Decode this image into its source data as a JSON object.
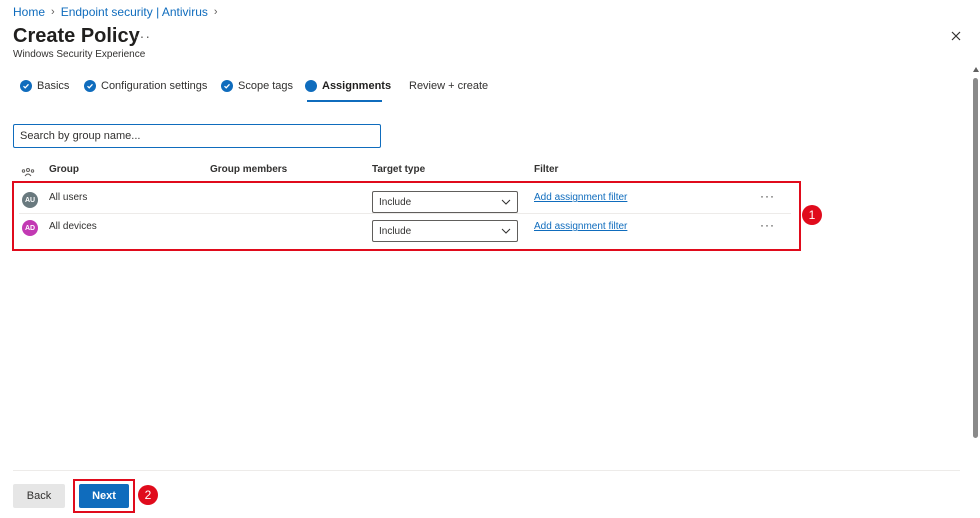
{
  "breadcrumb": {
    "items": [
      "Home",
      "Endpoint security | Antivirus"
    ]
  },
  "page": {
    "title": "Create Policy",
    "more": "···",
    "subtitle": "Windows Security Experience"
  },
  "tabs": [
    {
      "label": "Basics",
      "state": "completed"
    },
    {
      "label": "Configuration settings",
      "state": "completed"
    },
    {
      "label": "Scope tags",
      "state": "completed"
    },
    {
      "label": "Assignments",
      "state": "current"
    },
    {
      "label": "Review + create",
      "state": "pending"
    }
  ],
  "search": {
    "placeholder": "Search by group name..."
  },
  "table": {
    "columns": [
      "Group",
      "Group members",
      "Target type",
      "Filter"
    ],
    "rows": [
      {
        "initials": "AU",
        "avatar_color": "#69797e",
        "group": "All users",
        "target_type": "Include",
        "filter_link": "Add assignment filter",
        "more": "···"
      },
      {
        "initials": "AD",
        "avatar_color": "#c239b3",
        "group": "All devices",
        "target_type": "Include",
        "filter_link": "Add assignment filter",
        "more": "···"
      }
    ]
  },
  "annotations": {
    "badge_1": "1",
    "badge_2": "2"
  },
  "footer": {
    "back_label": "Back",
    "next_label": "Next"
  },
  "colors": {
    "accent": "#0f6cbd",
    "annotation_red": "#e00b1c"
  },
  "icons": [
    "chevron-right-icon",
    "close-icon",
    "check-circle-icon",
    "columns-icon",
    "chevron-down-icon",
    "more-icon"
  ]
}
